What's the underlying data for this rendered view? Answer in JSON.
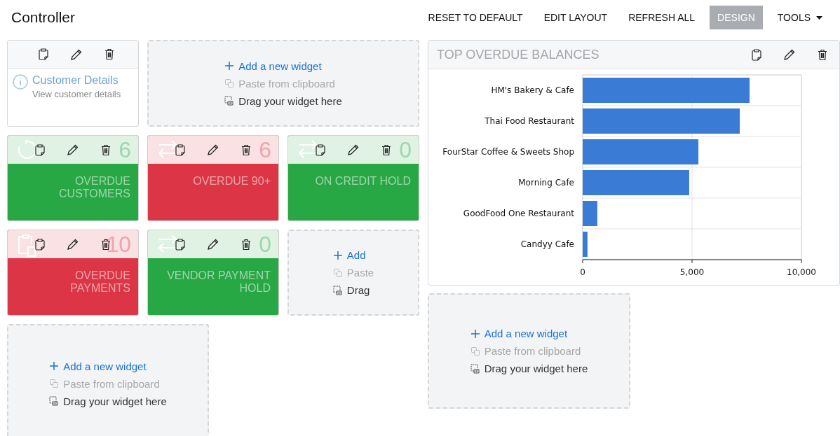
{
  "page_title": "Controller",
  "toolbar": [
    {
      "label": "RESET TO DEFAULT",
      "selected": false,
      "has_menu": false
    },
    {
      "label": "EDIT LAYOUT",
      "selected": false,
      "has_menu": false
    },
    {
      "label": "REFRESH ALL",
      "selected": false,
      "has_menu": false
    },
    {
      "label": "DESIGN",
      "selected": true,
      "has_menu": false
    },
    {
      "label": "TOOLS",
      "selected": false,
      "has_menu": true
    }
  ],
  "widgets": [
    {
      "kind": "info",
      "title": "Customer Details",
      "subtitle": "View customer details"
    },
    {
      "kind": "placeholder",
      "add": "Add a new widget",
      "paste": "Paste from clipboard",
      "drag": "Drag your widget here"
    },
    {
      "kind": "tile",
      "count": "6",
      "label": "OVERDUE CUSTOMERS",
      "color": "#28a745"
    },
    {
      "kind": "tile",
      "count": "6",
      "label": "OVERDUE 90+",
      "color": "#dc3545"
    },
    {
      "kind": "tile",
      "count": "0",
      "label": "ON CREDIT HOLD",
      "color": "#28a745"
    },
    {
      "kind": "tile",
      "count": "10",
      "label": "OVERDUE PAYMENTS",
      "color": "#dc3545"
    },
    {
      "kind": "tile",
      "count": "0",
      "label": "VENDOR PAYMENT HOLD",
      "color": "#28a745"
    },
    {
      "kind": "placeholder",
      "add": "Add",
      "paste": "Paste",
      "drag": "Drag"
    },
    {
      "kind": "placeholder",
      "add": "Add a new widget",
      "paste": "Paste from clipboard",
      "drag": "Drag your widget here"
    }
  ],
  "chart_widget": {
    "title": "TOP OVERDUE BALANCES",
    "chart_data": {
      "type": "bar",
      "orientation": "horizontal",
      "categories": [
        "HM's Bakery & Cafe",
        "Thai Food Restaurant",
        "FourStar Coffee & Sweets Shop",
        "Morning Cafe",
        "GoodFood One Restaurant",
        "Candyy Cafe"
      ],
      "series": [
        {
          "color": "#3a7bd5",
          "values": [
            7630,
            7180,
            5290,
            4870,
            670,
            220
          ]
        }
      ],
      "xlim": [
        0,
        10000
      ],
      "xticks": [
        {
          "value": 0,
          "label": "0"
        },
        {
          "value": 5000,
          "label": "5,000"
        },
        {
          "value": 10000,
          "label": "10,000"
        }
      ]
    }
  },
  "right_placeholder": {
    "add": "Add a new widget",
    "paste": "Paste from clipboard",
    "drag": "Drag your widget here"
  }
}
